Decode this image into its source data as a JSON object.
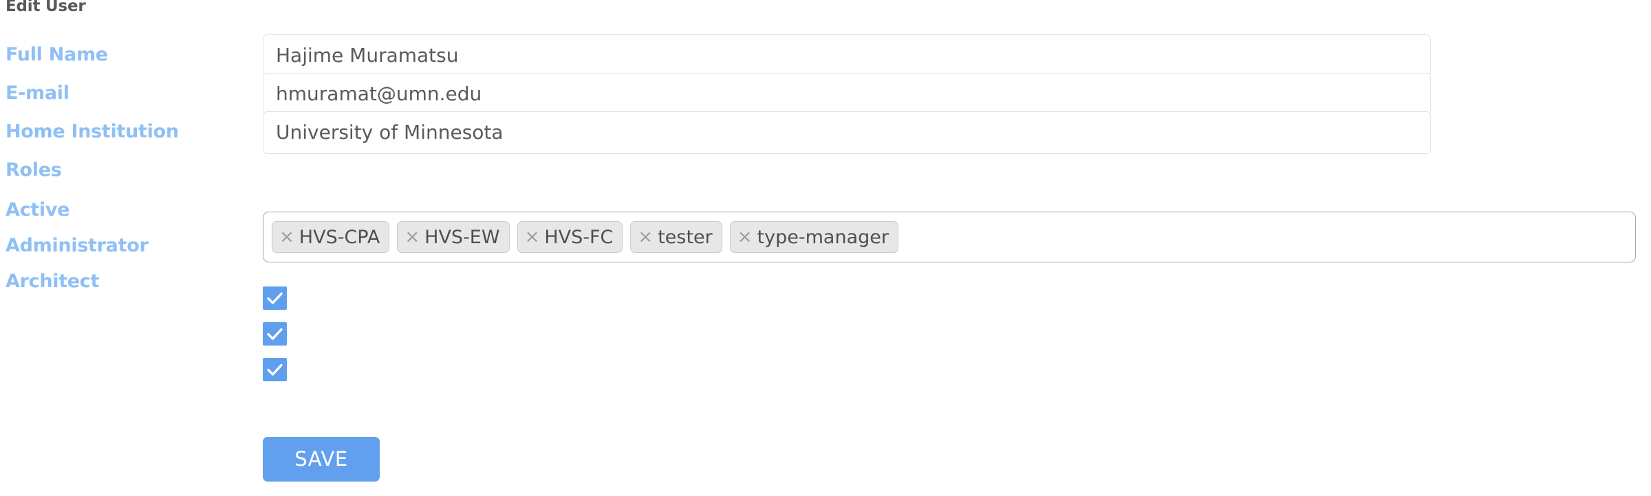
{
  "page": {
    "title": "Edit User"
  },
  "fields": {
    "full_name": {
      "label": "Full Name",
      "value": "Hajime Muramatsu",
      "placeholder": ""
    },
    "email": {
      "label": "E-mail",
      "value": "hmuramat@umn.edu",
      "placeholder": ""
    },
    "home_institution": {
      "label": "Home Institution",
      "value": "University of Minnesota",
      "placeholder": ""
    },
    "roles": {
      "label": "Roles",
      "tags": [
        {
          "label": "HVS-CPA",
          "remove": "×"
        },
        {
          "label": "HVS-EW",
          "remove": "×"
        },
        {
          "label": "HVS-FC",
          "remove": "×"
        },
        {
          "label": "tester",
          "remove": "×"
        },
        {
          "label": "type-manager",
          "remove": "×"
        }
      ]
    },
    "active": {
      "label": "Active",
      "checked": true
    },
    "administrator": {
      "label": "Administrator",
      "checked": true
    },
    "architect": {
      "label": "Architect",
      "checked": true
    }
  },
  "actions": {
    "save_label": "SAVE"
  },
  "colors": {
    "label_blue": "#8fc0f5",
    "title_gray": "#595959",
    "accent_blue": "#62a0ef",
    "checkbox_blue": "#5f9fee",
    "input_border": "#e2e2e2",
    "roles_border": "#a9a9a9",
    "tag_bg": "#e7e7e7",
    "tag_border": "#cccccc",
    "tag_text": "#4f4f4f",
    "value_text": "#5a5a5a"
  }
}
